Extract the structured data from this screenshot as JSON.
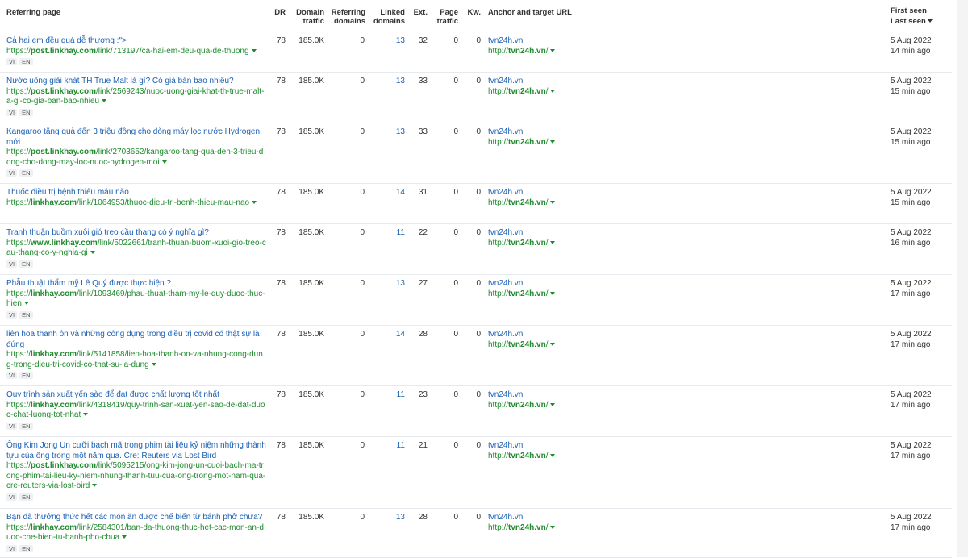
{
  "headers": {
    "referring_page": "Referring page",
    "dr": "DR",
    "domain_traffic_1": "Domain",
    "domain_traffic_2": "traffic",
    "ref_domains_1": "Referring",
    "ref_domains_2": "domains",
    "linked_domains_1": "Linked",
    "linked_domains_2": "domains",
    "ext": "Ext.",
    "page_traffic_1": "Page",
    "page_traffic_2": "traffic",
    "kw": "Kw.",
    "anchor": "Anchor and target URL",
    "first_seen": "First seen",
    "last_seen": "Last seen"
  },
  "rows": [
    {
      "title": "Cả hai em đều quá dễ thương :\">",
      "url_prefix": "https://",
      "url_host": "post.linkhay.com",
      "url_path": "/link/713197/ca-hai-em-deu-qua-de-thuong",
      "lang1": "VI",
      "lang2": "EN",
      "dr": "78",
      "traffic": "185.0K",
      "ref_domains": "0",
      "linked": "13",
      "ext": "32",
      "page_traffic": "0",
      "kw": "0",
      "anchor": "tvn24h.vn",
      "target_prefix": "http://",
      "target_host": "tvn24h.vn",
      "target_suffix": "/",
      "first_seen": "5 Aug 2022",
      "last_seen": "14 min ago"
    },
    {
      "title": "Nước uống giải khát TH True Malt là gì? Có giá bán bao nhiêu?",
      "url_prefix": "https://",
      "url_host": "post.linkhay.com",
      "url_path": "/link/2569243/nuoc-uong-giai-khat-th-true-malt-la-gi-co-gia-ban-bao-nhieu",
      "lang1": "VI",
      "lang2": "EN",
      "dr": "78",
      "traffic": "185.0K",
      "ref_domains": "0",
      "linked": "13",
      "ext": "33",
      "page_traffic": "0",
      "kw": "0",
      "anchor": "tvn24h.vn",
      "target_prefix": "http://",
      "target_host": "tvn24h.vn",
      "target_suffix": "/",
      "first_seen": "5 Aug 2022",
      "last_seen": "15 min ago"
    },
    {
      "title": "Kangaroo tặng quà đến 3 triệu đồng cho dòng máy lọc nước Hydrogen mới",
      "url_prefix": "https://",
      "url_host": "post.linkhay.com",
      "url_path": "/link/2703652/kangaroo-tang-qua-den-3-trieu-dong-cho-dong-may-loc-nuoc-hydrogen-moi",
      "lang1": "VI",
      "lang2": "EN",
      "dr": "78",
      "traffic": "185.0K",
      "ref_domains": "0",
      "linked": "13",
      "ext": "33",
      "page_traffic": "0",
      "kw": "0",
      "anchor": "tvn24h.vn",
      "target_prefix": "http://",
      "target_host": "tvn24h.vn",
      "target_suffix": "/",
      "first_seen": "5 Aug 2022",
      "last_seen": "15 min ago"
    },
    {
      "title": "Thuốc điều trị bệnh thiếu máu não",
      "url_prefix": "https://",
      "url_host": "linkhay.com",
      "url_path": "/link/1064953/thuoc-dieu-tri-benh-thieu-mau-nao",
      "lang1": "",
      "lang2": "",
      "dr": "78",
      "traffic": "185.0K",
      "ref_domains": "0",
      "linked": "14",
      "ext": "31",
      "page_traffic": "0",
      "kw": "0",
      "anchor": "tvn24h.vn",
      "target_prefix": "http://",
      "target_host": "tvn24h.vn",
      "target_suffix": "/",
      "first_seen": "5 Aug 2022",
      "last_seen": "15 min ago"
    },
    {
      "title": "Tranh thuận buồm xuôi gió treo cầu thang có ý nghĩa gì?",
      "url_prefix": "https://",
      "url_host": "www.linkhay.com",
      "url_path": "/link/5022661/tranh-thuan-buom-xuoi-gio-treo-cau-thang-co-y-nghia-gi",
      "lang1": "VI",
      "lang2": "EN",
      "dr": "78",
      "traffic": "185.0K",
      "ref_domains": "0",
      "linked": "11",
      "ext": "22",
      "page_traffic": "0",
      "kw": "0",
      "anchor": "tvn24h.vn",
      "target_prefix": "http://",
      "target_host": "tvn24h.vn",
      "target_suffix": "/",
      "first_seen": "5 Aug 2022",
      "last_seen": "16 min ago"
    },
    {
      "title": "Phẫu thuật thẩm mỹ Lê Quý được thực hiện ?",
      "url_prefix": "https://",
      "url_host": "linkhay.com",
      "url_path": "/link/1093469/phau-thuat-tham-my-le-quy-duoc-thuc-hien",
      "lang1": "VI",
      "lang2": "EN",
      "dr": "78",
      "traffic": "185.0K",
      "ref_domains": "0",
      "linked": "13",
      "ext": "27",
      "page_traffic": "0",
      "kw": "0",
      "anchor": "tvn24h.vn",
      "target_prefix": "http://",
      "target_host": "tvn24h.vn",
      "target_suffix": "/",
      "first_seen": "5 Aug 2022",
      "last_seen": "17 min ago"
    },
    {
      "title": "liên hoa thanh ôn và những công dụng trong điều trị covid có thật sự là đúng",
      "url_prefix": "https://",
      "url_host": "linkhay.com",
      "url_path": "/link/5141858/lien-hoa-thanh-on-va-nhung-cong-dung-trong-dieu-tri-covid-co-that-su-la-dung",
      "lang1": "VI",
      "lang2": "EN",
      "dr": "78",
      "traffic": "185.0K",
      "ref_domains": "0",
      "linked": "14",
      "ext": "28",
      "page_traffic": "0",
      "kw": "0",
      "anchor": "tvn24h.vn",
      "target_prefix": "http://",
      "target_host": "tvn24h.vn",
      "target_suffix": "/",
      "first_seen": "5 Aug 2022",
      "last_seen": "17 min ago"
    },
    {
      "title": "Quy trình sản xuất yến sào để đạt được chất lượng tốt nhất",
      "url_prefix": "https://",
      "url_host": "linkhay.com",
      "url_path": "/link/4318419/quy-trinh-san-xuat-yen-sao-de-dat-duoc-chat-luong-tot-nhat",
      "lang1": "VI",
      "lang2": "EN",
      "dr": "78",
      "traffic": "185.0K",
      "ref_domains": "0",
      "linked": "11",
      "ext": "23",
      "page_traffic": "0",
      "kw": "0",
      "anchor": "tvn24h.vn",
      "target_prefix": "http://",
      "target_host": "tvn24h.vn",
      "target_suffix": "/",
      "first_seen": "5 Aug 2022",
      "last_seen": "17 min ago"
    },
    {
      "title": "Ông Kim Jong Un cưỡi bạch mã trong phim tài liệu kỷ niệm những thành tựu của ông trong một năm qua. Cre: Reuters via Lost Bird",
      "url_prefix": "https://",
      "url_host": "post.linkhay.com",
      "url_path": "/link/5095215/ong-kim-jong-un-cuoi-bach-ma-trong-phim-tai-lieu-ky-niem-nhung-thanh-tuu-cua-ong-trong-mot-nam-qua-cre-reuters-via-lost-bird",
      "lang1": "VI",
      "lang2": "EN",
      "dr": "78",
      "traffic": "185.0K",
      "ref_domains": "0",
      "linked": "11",
      "ext": "21",
      "page_traffic": "0",
      "kw": "0",
      "anchor": "tvn24h.vn",
      "target_prefix": "http://",
      "target_host": "tvn24h.vn",
      "target_suffix": "/",
      "first_seen": "5 Aug 2022",
      "last_seen": "17 min ago"
    },
    {
      "title": "Bạn đã thưởng thức hết các món ăn được chế biến từ bánh phở chưa?",
      "url_prefix": "https://",
      "url_host": "linkhay.com",
      "url_path": "/link/2584301/ban-da-thuong-thuc-het-cac-mon-an-duoc-che-bien-tu-banh-pho-chua",
      "lang1": "VI",
      "lang2": "EN",
      "dr": "78",
      "traffic": "185.0K",
      "ref_domains": "0",
      "linked": "13",
      "ext": "28",
      "page_traffic": "0",
      "kw": "0",
      "anchor": "tvn24h.vn",
      "target_prefix": "http://",
      "target_host": "tvn24h.vn",
      "target_suffix": "/",
      "first_seen": "5 Aug 2022",
      "last_seen": "17 min ago"
    }
  ]
}
